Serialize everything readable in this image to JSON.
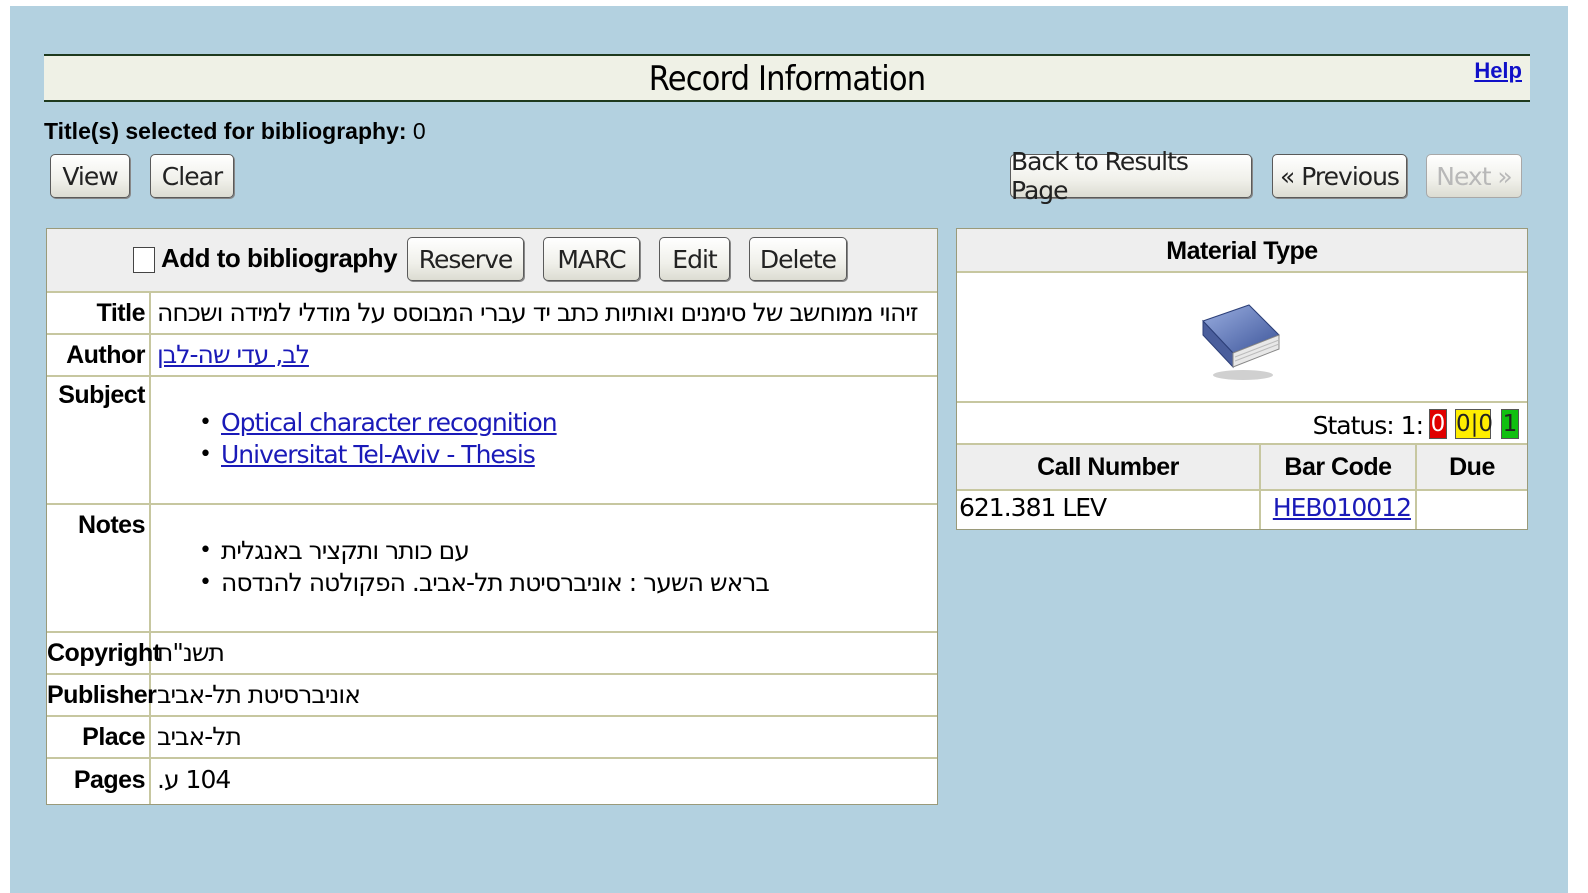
{
  "header": {
    "title": "Record Information",
    "help_label": "Help"
  },
  "bibliography": {
    "label": "Title(s) selected for bibliography:",
    "count": "0"
  },
  "toolbar": {
    "view_label": "View",
    "clear_label": "Clear",
    "back_label": "Back to Results Page",
    "previous_label": "« Previous",
    "next_label": "Next »"
  },
  "actions": {
    "add_to_bibliography": "Add to bibliography",
    "reserve": "Reserve",
    "marc": "MARC",
    "edit": "Edit",
    "delete": "Delete"
  },
  "record": {
    "title_label": "Title",
    "title_value": "זיהוי ממוחשב של סימנים ואותיות כתב יד עברי המבוסס על מודלי למידה ושכחה",
    "author_label": "Author",
    "author_value": "לב, עדי שה-לבן",
    "subject_label": "Subject",
    "subjects": [
      "Optical character recognition",
      "Universitat Tel-Aviv - Thesis"
    ],
    "notes_label": "Notes",
    "notes": [
      "עם כותר ותקציר באנגלית",
      "בראש השער : אוניברסיטת תל-אביב. הפקולטה להנדסה"
    ],
    "copyright_label": "Copyright",
    "copyright_value": "תשנ\"ח",
    "publisher_label": "Publisher",
    "publisher_value": "אוניברסיטת תל-אביב",
    "place_label": "Place",
    "place_value": "תל-אביב",
    "pages_label": "Pages",
    "pages_value": "104 ע."
  },
  "material": {
    "header": "Material Type",
    "icon": "book-icon",
    "status_label": "Status:  1:",
    "status_red": "0",
    "status_yellow": "0|0",
    "status_green": "1",
    "colors": {
      "red": "#e00000",
      "yellow": "#ffee00",
      "green": "#10c010"
    },
    "columns": {
      "call_number": "Call Number",
      "bar_code": "Bar Code",
      "due": "Due"
    },
    "holding": {
      "call_number": "621.381 LEV",
      "bar_code": "HEB010012",
      "due": ""
    }
  }
}
